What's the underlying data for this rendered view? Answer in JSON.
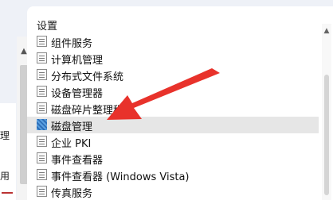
{
  "left_fragments": [
    "理",
    "用"
  ],
  "panel": {
    "title": "设置"
  },
  "items": [
    {
      "label": "组件服务",
      "icon": "document-list-icon"
    },
    {
      "label": "计算机管理",
      "icon": "document-list-icon"
    },
    {
      "label": "分布式文件系统",
      "icon": "document-list-icon"
    },
    {
      "label": "设备管理器",
      "icon": "document-list-icon"
    },
    {
      "label": "磁盘碎片整理程",
      "icon": "document-list-icon"
    },
    {
      "label": "磁盘管理",
      "icon": "disk-management-icon",
      "selected": true
    },
    {
      "label": "企业 PKI",
      "icon": "document-list-icon"
    },
    {
      "label": "事件查看器",
      "icon": "document-list-icon"
    },
    {
      "label": "事件查看器 (Windows Vista)",
      "icon": "document-list-icon"
    },
    {
      "label": "传真服务",
      "icon": "document-list-icon"
    }
  ],
  "colors": {
    "annotation_arrow": "#e8322b",
    "selected_row": "#e6e6e6"
  }
}
